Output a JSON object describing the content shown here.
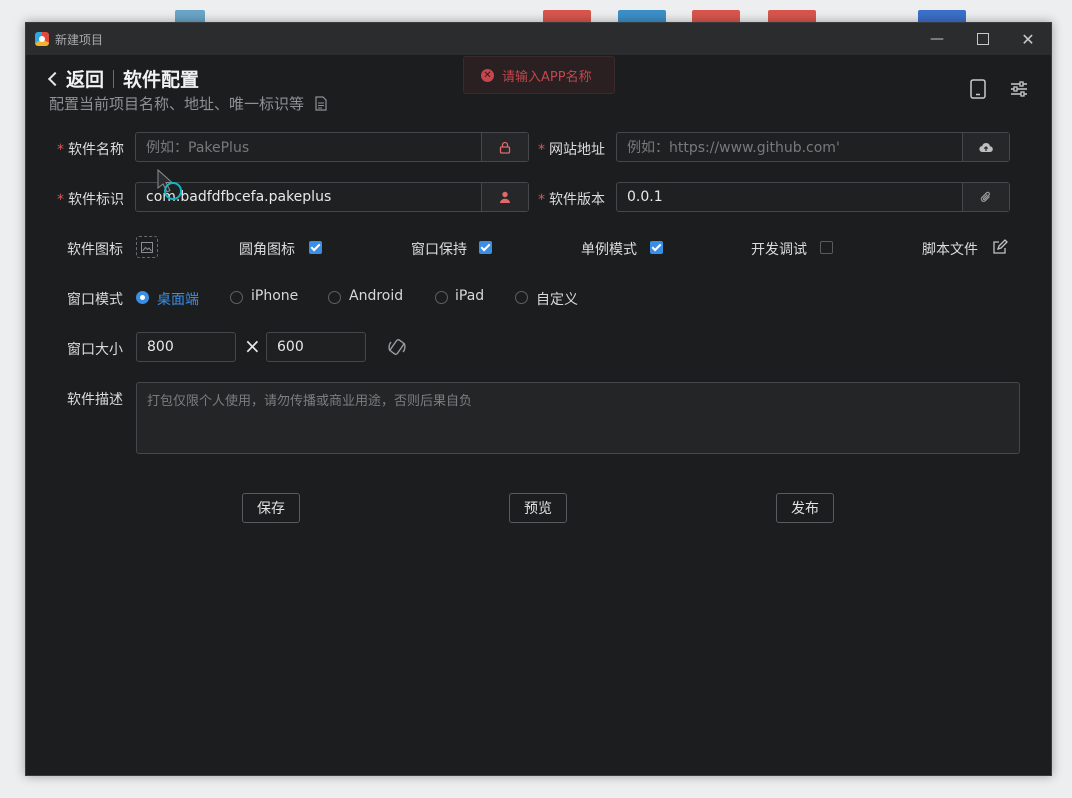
{
  "window": {
    "title": "新建项目"
  },
  "header": {
    "back_label": "返回",
    "page_title": "软件配置",
    "subtitle": "配置当前项目名称、地址、唯一标识等"
  },
  "toast": {
    "message": "请输入APP名称"
  },
  "form": {
    "name": {
      "label": "软件名称",
      "placeholder": "例如：PakePlus",
      "value": ""
    },
    "url": {
      "label": "网站地址",
      "placeholder": "例如：https://www.github.com'",
      "value": ""
    },
    "identifier": {
      "label": "软件标识",
      "value": "com.​badfdfbcefa.pakeplus"
    },
    "version": {
      "label": "软件版本",
      "value": "0.0.1"
    },
    "icon": {
      "label": "软件图标"
    },
    "rounded_icon": {
      "label": "圆角图标",
      "checked": true
    },
    "keep_window": {
      "label": "窗口保持",
      "checked": true
    },
    "single_instance": {
      "label": "单例模式",
      "checked": true
    },
    "dev_debug": {
      "label": "开发调试",
      "checked": false
    },
    "script_file": {
      "label": "脚本文件"
    },
    "window_mode": {
      "label": "窗口模式",
      "options": [
        "桌面端",
        "iPhone",
        "Android",
        "iPad",
        "自定义"
      ],
      "selected": "桌面端"
    },
    "window_size": {
      "label": "窗口大小",
      "width": "800",
      "height": "600",
      "separator": "×"
    },
    "description": {
      "label": "软件描述",
      "placeholder": "打包仅限个人使用，请勿传播或商业用途，否则后果自负"
    }
  },
  "actions": {
    "save": "保存",
    "preview": "预览",
    "publish": "发布"
  },
  "colors": {
    "accent": "#3a8ee6",
    "required": "#e25357",
    "background": "#1c1d1f"
  }
}
